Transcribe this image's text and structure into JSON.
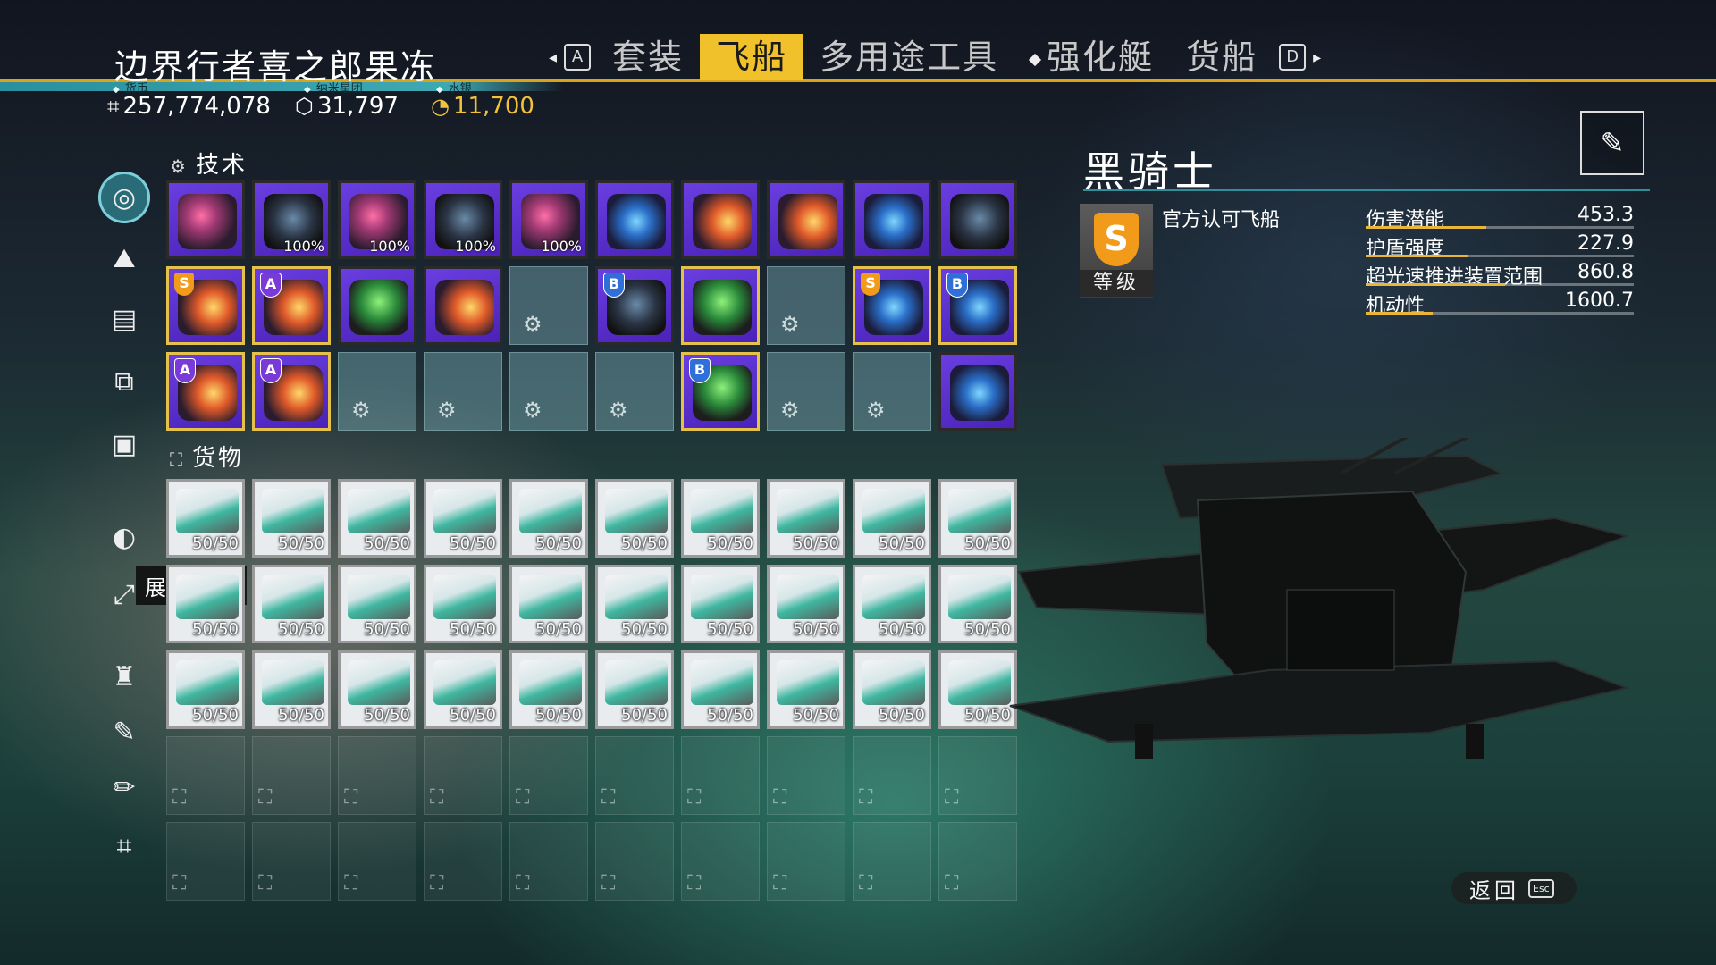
{
  "header": {
    "title": "边界行者喜之郎果冻",
    "tabs": [
      {
        "label": "套装",
        "active": false
      },
      {
        "label": "飞船",
        "active": true
      },
      {
        "label": "多用途工具",
        "active": false
      },
      {
        "label": "强化艇",
        "active": false
      },
      {
        "label": "货船",
        "active": false
      }
    ],
    "key_left": "A",
    "key_right": "D"
  },
  "currencies": [
    {
      "label": "货币",
      "value": "257,774,078",
      "icon": "units-icon"
    },
    {
      "label": "纳米星团",
      "value": "31,797",
      "icon": "nanites-icon"
    },
    {
      "label": "水银",
      "value": "11,700",
      "icon": "quicksilver-icon"
    }
  ],
  "technology": {
    "label": "技术",
    "rows": [
      [
        {
          "type": "tech",
          "badge": "",
          "pct": "",
          "art": "pink",
          "gold": false
        },
        {
          "type": "tech",
          "badge": "",
          "pct": "100%",
          "art": "dark",
          "gold": false
        },
        {
          "type": "tech",
          "badge": "",
          "pct": "100%",
          "art": "pink",
          "gold": false
        },
        {
          "type": "tech",
          "badge": "",
          "pct": "100%",
          "art": "dark",
          "gold": false
        },
        {
          "type": "tech",
          "badge": "",
          "pct": "100%",
          "art": "pink",
          "gold": false
        },
        {
          "type": "tech",
          "badge": "",
          "pct": "",
          "art": "blue",
          "gold": false
        },
        {
          "type": "tech",
          "badge": "",
          "pct": "",
          "art": "fire",
          "gold": false
        },
        {
          "type": "tech",
          "badge": "",
          "pct": "",
          "art": "fire",
          "gold": false
        },
        {
          "type": "tech",
          "badge": "",
          "pct": "",
          "art": "blue",
          "gold": false
        },
        {
          "type": "tech",
          "badge": "",
          "pct": "",
          "art": "dark",
          "gold": false
        }
      ],
      [
        {
          "type": "tech",
          "badge": "S",
          "pct": "",
          "art": "fire",
          "gold": true
        },
        {
          "type": "tech",
          "badge": "A",
          "pct": "",
          "art": "fire",
          "gold": true
        },
        {
          "type": "tech",
          "badge": "",
          "pct": "",
          "art": "green",
          "gold": false
        },
        {
          "type": "tech",
          "badge": "",
          "pct": "",
          "art": "fire",
          "gold": false
        },
        {
          "type": "empty"
        },
        {
          "type": "tech",
          "badge": "B",
          "pct": "",
          "art": "dark",
          "gold": false
        },
        {
          "type": "tech",
          "badge": "",
          "pct": "",
          "art": "green",
          "gold": true
        },
        {
          "type": "empty"
        },
        {
          "type": "tech",
          "badge": "S",
          "pct": "",
          "art": "blue",
          "gold": true
        },
        {
          "type": "tech",
          "badge": "B",
          "pct": "",
          "art": "blue",
          "gold": true
        }
      ],
      [
        {
          "type": "tech",
          "badge": "A",
          "pct": "",
          "art": "fire",
          "gold": true
        },
        {
          "type": "tech",
          "badge": "A",
          "pct": "",
          "art": "fire",
          "gold": true
        },
        {
          "type": "empty"
        },
        {
          "type": "empty"
        },
        {
          "type": "empty"
        },
        {
          "type": "empty"
        },
        {
          "type": "tech",
          "badge": "B",
          "pct": "",
          "art": "green",
          "gold": true
        },
        {
          "type": "empty"
        },
        {
          "type": "empty"
        },
        {
          "type": "tech",
          "badge": "",
          "pct": "",
          "art": "blue",
          "gold": false
        }
      ]
    ]
  },
  "cargo": {
    "label": "货物",
    "filled_quantity": "50/50",
    "filled_rows": 3,
    "empty_rows": 2,
    "columns": 10
  },
  "sidebar": {
    "icons": [
      "ship-icon",
      "planet-icon",
      "storage-icon",
      "transfer-icon",
      "catalog-icon",
      "expand-icon",
      "resize-icon",
      "suit-icon",
      "clean-icon",
      "edit-icon",
      "units-icon"
    ],
    "tooltip": "展开技术"
  },
  "ship": {
    "name": "黑骑士",
    "class": "S",
    "class_label": "等级",
    "subtitle": "官方认可飞船",
    "stats": [
      {
        "name": "伤害潜能",
        "value": "453.3",
        "fill": 0.45,
        "color": "#e9b63a"
      },
      {
        "name": "护盾强度",
        "value": "227.9",
        "fill": 0.38,
        "color": "#e9b63a"
      },
      {
        "name": "超光速推进装置范围",
        "value": "860.8",
        "fill": 0.52,
        "color": "#e9b63a"
      },
      {
        "name": "机动性",
        "value": "1600.7",
        "fill": 0.25,
        "color": "#e9b63a"
      }
    ]
  },
  "footer": {
    "back_label": "返回",
    "back_key": "Esc"
  },
  "colors": {
    "accent": "#f0c12b",
    "teal": "#2f8f9a",
    "tech_purple": "#5a2fd0"
  }
}
